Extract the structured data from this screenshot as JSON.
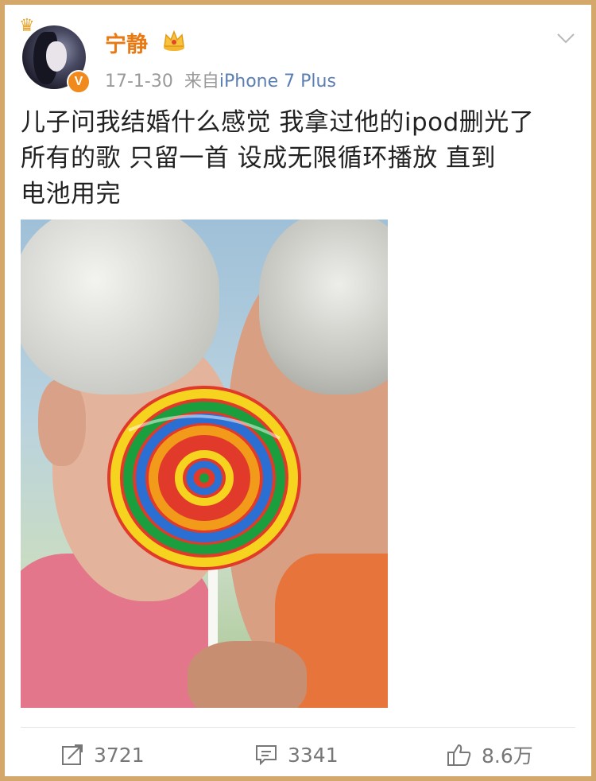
{
  "user": {
    "name": "宁静",
    "verified_badge": "V",
    "verified_color": "#f08a1c",
    "name_color": "#e87a13"
  },
  "meta": {
    "date": "17-1-30",
    "source_prefix": "来自",
    "source": "iPhone 7 Plus"
  },
  "post": {
    "lines": [
      "儿子问我结婚什么感觉 我拿过他的ipod删光了",
      "所有的歌  只留一首  设成无限循环播放  直到",
      "电池用完"
    ]
  },
  "icons": {
    "vip": "crown-icon",
    "menu": "chevron-down-icon",
    "repost": "repost-icon",
    "comment": "comment-icon",
    "like": "thumbs-up-icon"
  },
  "actions": {
    "repost_count": "3721",
    "comment_count": "3341",
    "like_count": "8.6万"
  }
}
